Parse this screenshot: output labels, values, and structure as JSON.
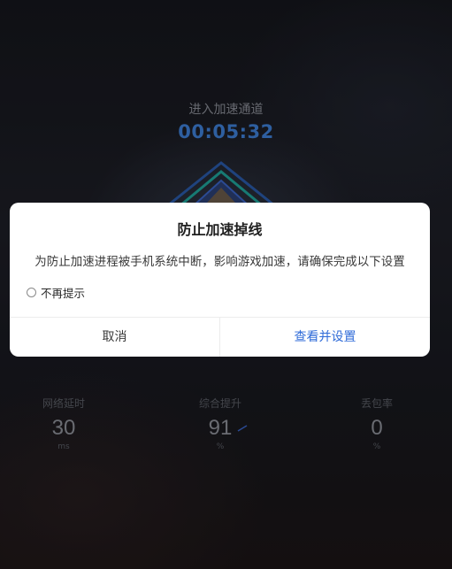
{
  "screen": {
    "header_label": "进入加速通道",
    "timer": "00:05:32"
  },
  "stats": [
    {
      "label": "网络延时",
      "value": "30",
      "unit": "ms"
    },
    {
      "label": "综合提升",
      "value": "91",
      "unit": "%"
    },
    {
      "label": "丢包率",
      "value": "0",
      "unit": "%"
    }
  ],
  "dialog": {
    "title": "防止加速掉线",
    "message": "为防止加速进程被手机系统中断，影响游戏加速，请确保完成以下设置",
    "checkbox_label": "不再提示",
    "checkbox_checked": false,
    "cancel_label": "取消",
    "confirm_label": "查看并设置"
  },
  "colors": {
    "accent": "#2f6bd8",
    "timer": "#3e7fd6",
    "emblem_teal": "#1fa39a"
  }
}
